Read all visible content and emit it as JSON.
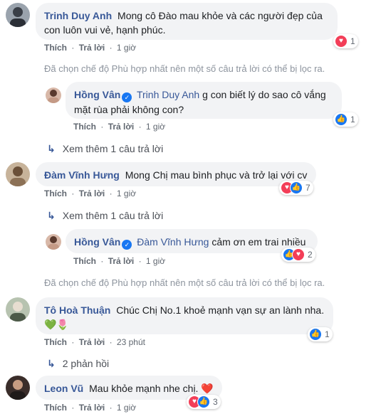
{
  "actions": {
    "like": "Thích",
    "reply": "Trả lời",
    "separator": "·"
  },
  "comments": [
    {
      "author": "Trinh Duy Anh",
      "text": "Mong cô Đào mau khỏe và các người đẹp của con luôn vui vẻ, hạnh phúc.",
      "time": "1 giờ",
      "reaction_count": "1",
      "reactions": [
        "heart"
      ]
    },
    {
      "author": "Hồng Vân",
      "verified": true,
      "tag": "Trinh Duy Anh",
      "text": "g con biết lý do sao cô vắng mặt rùa phải không con?",
      "time": "1 giờ",
      "reaction_count": "1",
      "reactions": [
        "like"
      ]
    },
    {
      "author": "Đàm Vĩnh Hưng",
      "text": "Mong Chị mau bình phục và trở lại với cv",
      "time": "1 giờ",
      "reaction_count": "7",
      "reactions": [
        "heart",
        "like"
      ]
    },
    {
      "author": "Hồng Vân",
      "verified": true,
      "tag": "Đàm Vĩnh Hưng",
      "text": "cảm ơn em trai nhiều",
      "time": "1 giờ",
      "reaction_count": "2",
      "reactions": [
        "like",
        "heart"
      ]
    },
    {
      "author": "Tô Hoà Thuận",
      "text": "Chúc Chị No.1 khoẻ mạnh vạn sự an lành nha.",
      "emoji": "💚🌷",
      "time": "23 phút",
      "reaction_count": "1",
      "reactions": [
        "like"
      ]
    },
    {
      "author": "Leon Vũ",
      "text": "Mau khỏe mạnh nhe chị.",
      "emoji": "❤️",
      "time": "1 giờ",
      "reaction_count": "3",
      "reactions": [
        "heart",
        "like"
      ]
    }
  ],
  "notices": [
    "Đã chọn chế độ Phù hợp nhất nên một số câu trả lời có thể bị lọc ra.",
    "Đã chọn chế độ Phù hợp nhất nên một số câu trả lời có thể bị lọc ra."
  ],
  "more_replies": [
    "Xem thêm 1 câu trả lời",
    "Xem thêm 1 câu trả lời",
    "2 phản hồi"
  ],
  "colors": {
    "link": "#385898",
    "bubble": "#f2f3f5",
    "like": "#1877f2",
    "heart": "#f33e58"
  },
  "icons": {
    "reply_arrow": "reply-arrow-icon",
    "like": "like-reaction-icon",
    "heart": "heart-reaction-icon",
    "verified": "verified-badge-icon"
  }
}
